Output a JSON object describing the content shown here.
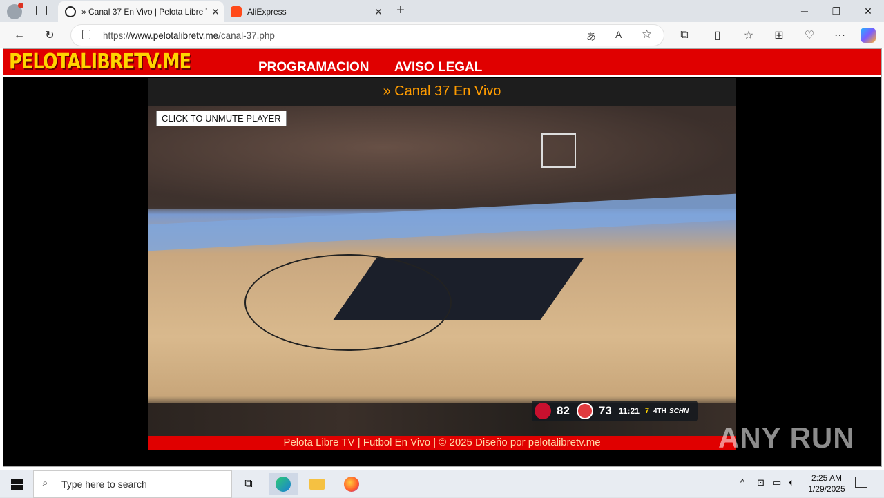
{
  "browser": {
    "tabs": [
      {
        "title": "» Canal 37 En Vivo | Pelota Libre TV",
        "active": true
      },
      {
        "title": "AliExpress",
        "active": false
      }
    ],
    "url_prefix": "https://",
    "url_domain": "www.pelotalibretv.me",
    "url_path": "/canal-37.php"
  },
  "site": {
    "logo": "PELOTALIBRETV.ME",
    "menu": [
      "PROGRAMACION",
      "AVISO LEGAL"
    ],
    "channel_title": "» Canal 37 En Vivo",
    "unmute_label": "CLICK TO UNMUTE PLAYER",
    "footer": "Pelota Libre TV | Futbol En Vivo | © 2025 Diseño por pelotalibretv.me"
  },
  "scorebug": {
    "home_score": "82",
    "away_score": "73",
    "clock": "11:21",
    "shot_clock": "7",
    "period": "4TH",
    "network": "SCHN"
  },
  "watermark": "ANY RUN",
  "taskbar": {
    "search_placeholder": "Type here to search",
    "time": "2:25 AM",
    "date": "1/29/2025"
  },
  "colors": {
    "header_red": "#e00000",
    "logo_yellow": "#ffd400",
    "title_orange": "#ff9c00"
  }
}
